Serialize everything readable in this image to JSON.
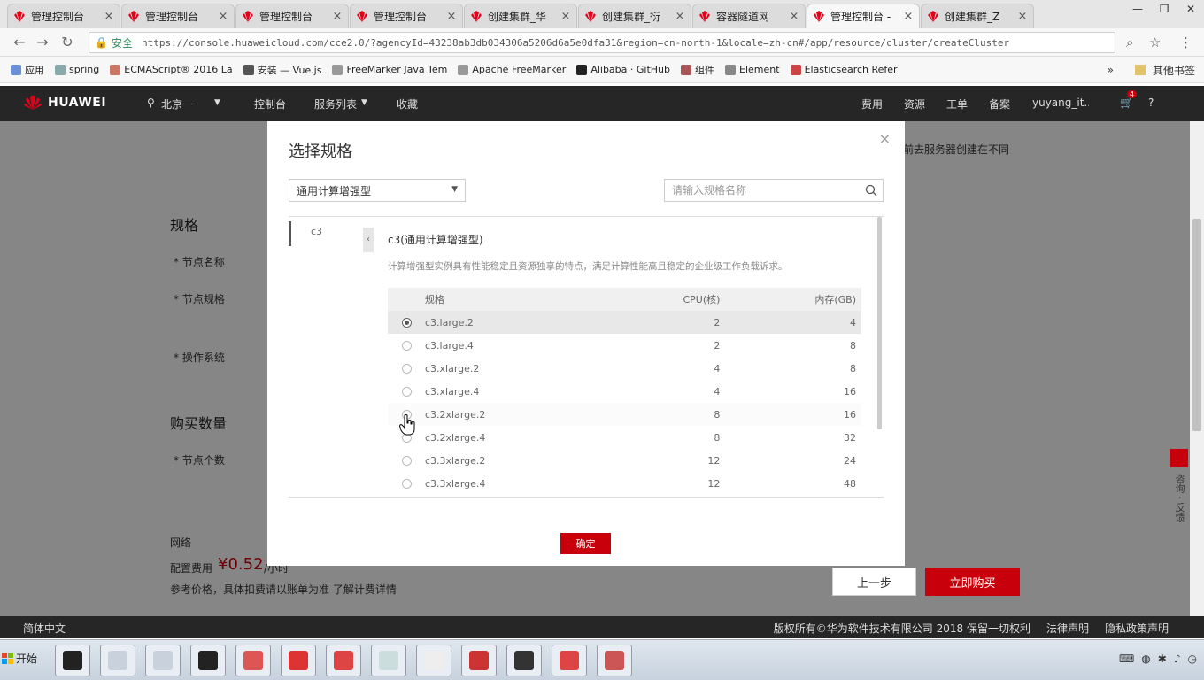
{
  "browser": {
    "tabs": [
      {
        "label": "管理控制台",
        "active": false
      },
      {
        "label": "管理控制台",
        "active": false
      },
      {
        "label": "管理控制台",
        "active": false
      },
      {
        "label": "管理控制台",
        "active": false
      },
      {
        "label": "创建集群_华",
        "active": false
      },
      {
        "label": "创建集群_衍",
        "active": false
      },
      {
        "label": "容器隧道网",
        "active": false
      },
      {
        "label": "管理控制台 -",
        "active": true
      },
      {
        "label": "创建集群_Z",
        "active": false
      }
    ],
    "secure_label": "安全",
    "url": "https://console.huaweicloud.com/cce2.0/?agencyId=43238ab3db034306a5206d6a5e0dfa31&region=cn-north-1&locale=zh-cn#/app/resource/cluster/createCluster",
    "bookmarks": [
      "应用",
      "spring",
      "ECMAScript® 2016 La",
      "安装 — Vue.js",
      "FreeMarker Java Tem",
      "Apache FreeMarker",
      "Alibaba · GitHub",
      "组件",
      "Element",
      "Elasticsearch Refer"
    ],
    "bookmarks_overflow": "»",
    "other_bookmarks": "其他书签"
  },
  "header": {
    "logo": "HUAWEI",
    "region": "北京一",
    "nav": [
      "控制台",
      "服务列表",
      "收藏"
    ],
    "right": [
      "费用",
      "资源",
      "工单",
      "备案",
      "yuyang_it..."
    ],
    "badge": "4"
  },
  "background": {
    "note_fragment": "前去服务器创建在不同",
    "spec_heading": "规格",
    "node_name_label": "* 节点名称",
    "node_spec_label": "* 节点规格",
    "os_label": "* 操作系统",
    "quantity_heading": "购买数量",
    "node_count_label": "* 节点个数",
    "fee_heading": "网络",
    "price_label": "配置费用",
    "price_value": "¥0.52",
    "price_unit": "/小时",
    "price_note": "参考价格，具体扣费请以账单为准 了解计费详情",
    "prev_button": "上一步",
    "buy_button": "立即购买",
    "side_tab": "咨询 · 反馈"
  },
  "dialog": {
    "title": "选择规格",
    "category_select": "通用计算增强型",
    "search_placeholder": "请输入规格名称",
    "family_item": "c3",
    "family_title": "c3(通用计算增强型)",
    "family_desc": "计算增强型实例具有性能稳定且资源独享的特点，满足计算性能高且稳定的企业级工作负载诉求。",
    "table": {
      "headers": [
        "规格",
        "CPU(核)",
        "内存(GB)"
      ],
      "rows": [
        {
          "name": "c3.large.2",
          "cpu": "2",
          "mem": "4",
          "selected": true
        },
        {
          "name": "c3.large.4",
          "cpu": "2",
          "mem": "8",
          "selected": false
        },
        {
          "name": "c3.xlarge.2",
          "cpu": "4",
          "mem": "8",
          "selected": false
        },
        {
          "name": "c3.xlarge.4",
          "cpu": "4",
          "mem": "16",
          "selected": false
        },
        {
          "name": "c3.2xlarge.2",
          "cpu": "8",
          "mem": "16",
          "selected": false
        },
        {
          "name": "c3.2xlarge.4",
          "cpu": "8",
          "mem": "32",
          "selected": false
        },
        {
          "name": "c3.3xlarge.2",
          "cpu": "12",
          "mem": "24",
          "selected": false
        },
        {
          "name": "c3.3xlarge.4",
          "cpu": "12",
          "mem": "48",
          "selected": false
        }
      ]
    },
    "confirm_button": "确定",
    "close_glyph": "×"
  },
  "footer": {
    "language": "简体中文",
    "copyright": "版权所有©华为软件技术有限公司 2018 保留一切权利",
    "legal": "法律声明",
    "privacy": "隐私政策声明"
  },
  "taskbar": {
    "start_label": "开始"
  },
  "colors": {
    "brand_red": "#c7000b",
    "header_dark": "#262626"
  }
}
